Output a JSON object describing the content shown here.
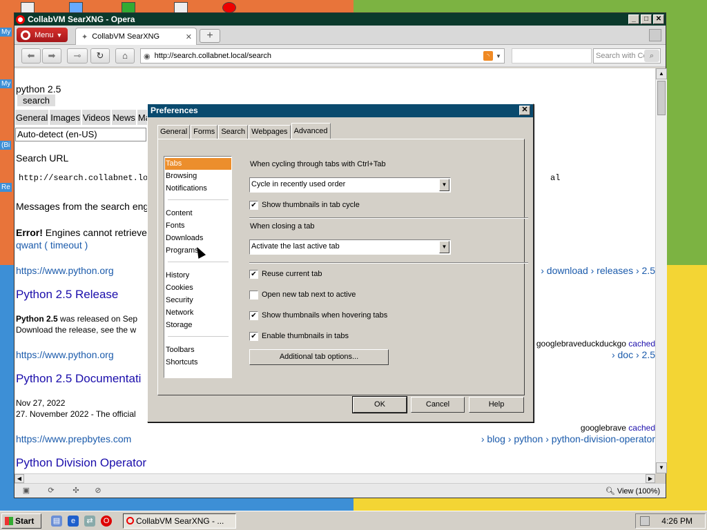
{
  "desktop": {
    "side_labels": [
      "My",
      "My",
      "(Bi",
      "Re"
    ]
  },
  "window": {
    "title": "CollabVM SearXNG - Opera",
    "controls": {
      "minimize": "_",
      "maximize": "□",
      "close": "✕"
    }
  },
  "tabbar": {
    "menu_label": "Menu",
    "active_tab_title": "CollabVM SearXNG",
    "new_tab_symbol": "+"
  },
  "navbar": {
    "url": "http://search.collabnet.local/search",
    "search_placeholder": "Search with Co"
  },
  "page": {
    "query": "python 2.5",
    "search_button": "search",
    "categories": [
      "General",
      "Images",
      "Videos",
      "News",
      "Ma"
    ],
    "language": "Auto-detect (en-US)",
    "search_url_heading": "Search URL",
    "search_url_value": "http://search.collabnet.lo",
    "search_url_tail": "al",
    "messages_heading": "Messages from the search eng",
    "error_label": "Error!",
    "error_text": "Engines cannot retrieve",
    "error_engine": "qwant (",
    "error_reason": "timeout",
    "error_close": ")",
    "results": [
      {
        "url": "https://www.python.org",
        "breadcrumb": "› download › releases › 2.5",
        "title": "Python 2.5 Release",
        "snippet_bold": "Python 2.5",
        "snippet_line1": " was released on Sep",
        "snippet_line2": "Download the release, see the w",
        "engines": "googlebraveduckduckgo",
        "cached": "cached"
      },
      {
        "url": "https://www.python.org",
        "breadcrumb": "› doc › 2.5",
        "title": "Python 2.5 Documentati",
        "date": "Nov 27, 2022",
        "snippet_line1": "27. November 2022 - The official",
        "engines": "googlebrave",
        "cached": "cached"
      },
      {
        "url": "https://www.prepbytes.com",
        "breadcrumb": "› blog › python › python-division-operator",
        "title": "Python Division Operator"
      }
    ]
  },
  "statusbar": {
    "view_label": "View (100%)"
  },
  "dialog": {
    "title": "Preferences",
    "tabs": [
      "General",
      "Forms",
      "Search",
      "Webpages",
      "Advanced"
    ],
    "active_tab": "Advanced",
    "categories": {
      "group1": [
        "Tabs",
        "Browsing",
        "Notifications"
      ],
      "group2": [
        "Content",
        "Fonts",
        "Downloads",
        "Programs"
      ],
      "group3": [
        "History",
        "Cookies",
        "Security",
        "Network",
        "Storage"
      ],
      "group4": [
        "Toolbars",
        "Shortcuts"
      ]
    },
    "selected_category": "Tabs",
    "cycle_label": "When cycling through tabs with Ctrl+Tab",
    "cycle_value": "Cycle in recently used order",
    "show_thumbs_cycle": "Show thumbnails in tab cycle",
    "closing_label": "When closing a tab",
    "closing_value": "Activate the last active tab",
    "options": [
      {
        "label": "Reuse current tab",
        "checked": true
      },
      {
        "label": "Open new tab next to active",
        "checked": false
      },
      {
        "label": "Show thumbnails when hovering tabs",
        "checked": true
      },
      {
        "label": "Enable thumbnails in tabs",
        "checked": true
      }
    ],
    "show_thumbs_cycle_checked": true,
    "additional_button": "Additional tab options...",
    "ok": "OK",
    "cancel": "Cancel",
    "help": "Help"
  },
  "taskbar": {
    "start": "Start",
    "task_title": "CollabVM SearXNG - ...",
    "clock": "4:26 PM"
  }
}
